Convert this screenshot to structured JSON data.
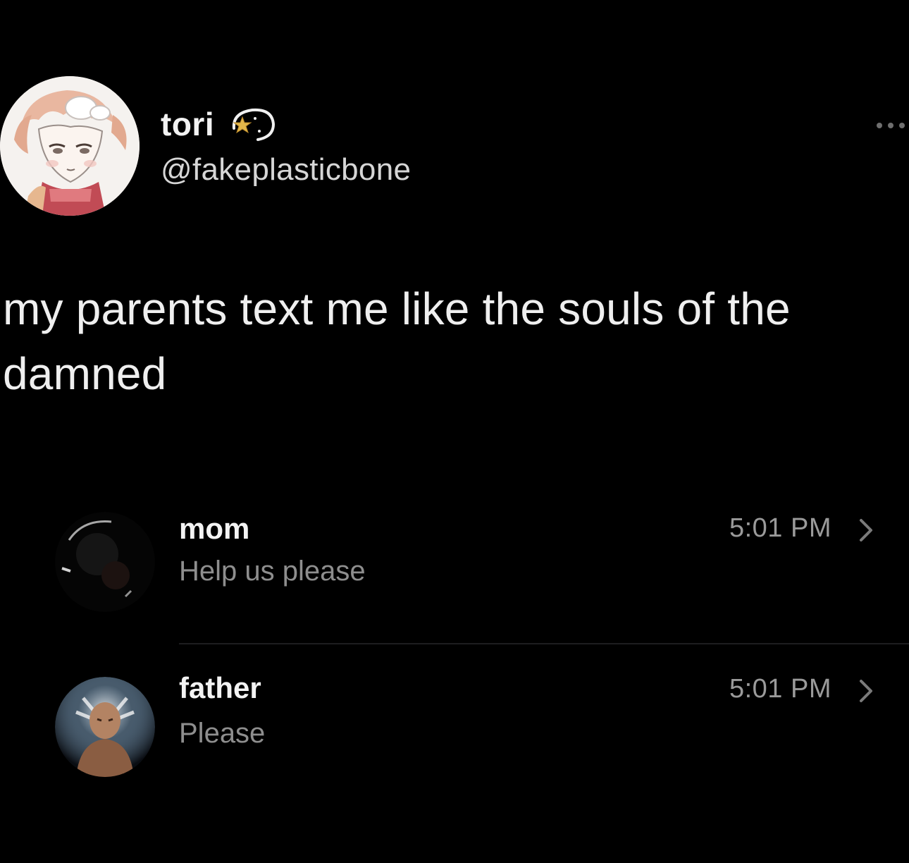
{
  "tweet": {
    "author": {
      "display_name": "tori",
      "handle": "@fakeplasticbone",
      "badge_icon": "star-swirl-icon",
      "avatar_icon": "anime-avatar"
    },
    "text": "my parents text me like the souls of the damned",
    "menu_icon": "more-icon"
  },
  "messages": [
    {
      "name": "mom",
      "preview": "Help us please",
      "time": "5:01 PM",
      "avatar_icon": "dark-avatar"
    },
    {
      "name": "father",
      "preview": "Please",
      "time": "5:01 PM",
      "avatar_icon": "glowing-figure-avatar"
    }
  ],
  "colors": {
    "background": "#000000",
    "primary_text": "#efefef",
    "secondary_text": "#8e8e8e",
    "badge_gold": "#e2b64a"
  }
}
